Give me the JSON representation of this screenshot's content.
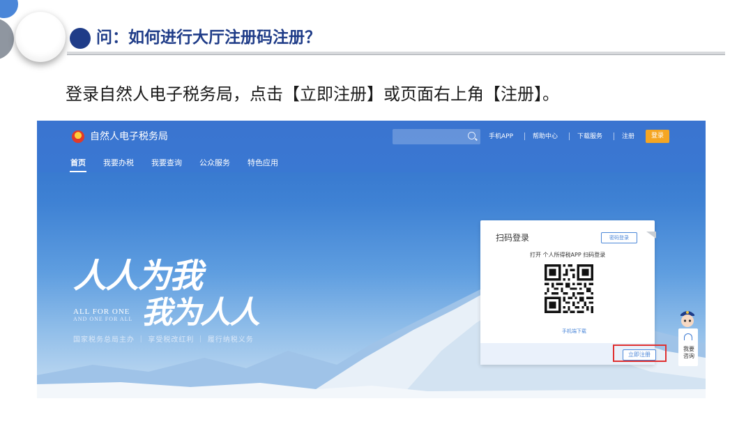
{
  "slide": {
    "title": "问：如何进行大厅注册码注册？",
    "instruction": "登录自然人电子税务局，点击【立即注册】或页面右上角【注册】。"
  },
  "website": {
    "site_name": "自然人电子税务局",
    "top_links": [
      "手机APP",
      "帮助中心",
      "下载服务",
      "注册"
    ],
    "login_button": "登录",
    "tabs": [
      "首页",
      "我要办税",
      "我要查询",
      "公众服务",
      "特色应用"
    ],
    "active_tab": "首页",
    "slogan_line1": "人人为我",
    "slogan_line2": "我为人人",
    "slogan_en_line1": "ALL FOR ONE",
    "slogan_en_line2": "AND ONE FOR ALL",
    "slogan_sub": "国家税务总局主办 ｜ 享受税改红利 ｜ 履行纳税义务",
    "login_card": {
      "title": "扫码登录",
      "password_login": "密码登录",
      "hint": "打开 个人所得税APP 扫码登录",
      "download": "手机端下载",
      "register_button": "立即注册"
    },
    "assistant_label": "我要咨询"
  },
  "colors": {
    "title_blue": "#1f3c88",
    "nav_blue": "#3a78d2",
    "login_orange": "#f5a623",
    "highlight_red": "#e03030"
  }
}
